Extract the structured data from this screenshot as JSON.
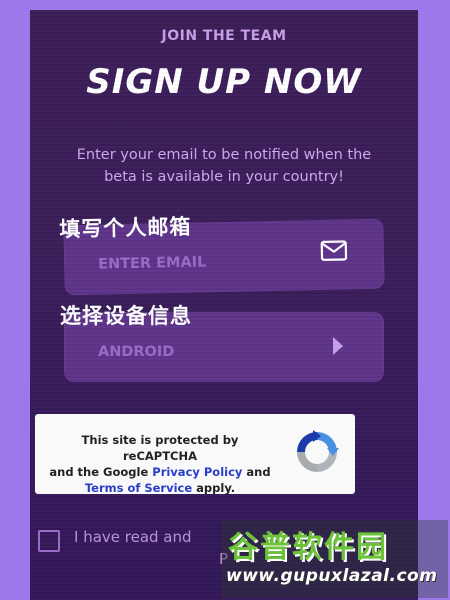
{
  "header": {
    "eyebrow": "JOIN THE TEAM",
    "title": "SIGN UP NOW",
    "subtitle": "Enter your email to be notified when the beta is available in your country!"
  },
  "email_field": {
    "hint": "填写个人邮箱",
    "placeholder": "ENTER EMAIL",
    "icon": "mail-icon"
  },
  "device_field": {
    "hint": "选择设备信息",
    "value": "ANDROID",
    "icon": "chevron-right-icon"
  },
  "recaptcha": {
    "line1": "This site is protected by reCAPTCHA",
    "line2_prefix": "and the Google ",
    "privacy_link": "Privacy Policy",
    "line2_suffix": " and",
    "terms_link": "Terms of Service",
    "line3_suffix": " apply.",
    "logo": "recaptcha-logo-icon"
  },
  "consent": {
    "label_visible": "I have read and",
    "link_partial": "P"
  },
  "watermark": {
    "text": "谷普软件园",
    "url": "www.gupuxlazal.com"
  },
  "colors": {
    "page_bg": "#9b79ea",
    "panel_bg": "#3a1e5a",
    "field_bg": "#5e3489",
    "accent_text": "#d1a7f0"
  }
}
